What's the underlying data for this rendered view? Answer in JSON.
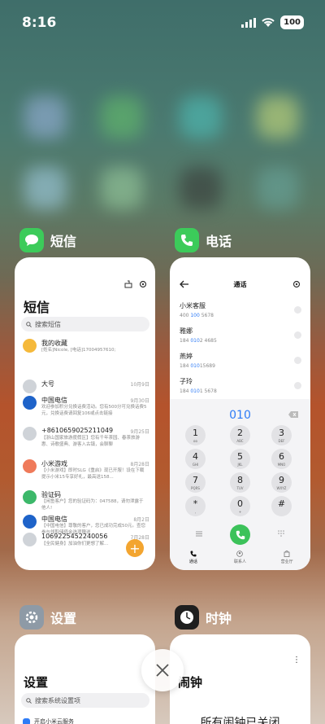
{
  "status_bar": {
    "time": "8:16",
    "battery": "100"
  },
  "recent_apps": {
    "sms": {
      "label": "短信",
      "title": "短信",
      "search_placeholder": "搜索短信",
      "messages": [
        {
          "name": "我的收藏",
          "date": "",
          "preview": "[姓名]Nicole, [电话]17004957610;",
          "avatar_color": "#f5b93b"
        },
        {
          "name": "大号",
          "date": "10月9日",
          "preview": "",
          "avatar_color": "#cfd3d8"
        },
        {
          "name": "中国电信",
          "date": "9月30日",
          "preview": "欢迎参加积分兑换话费活动。您有500分可兑换话费5元，兑换话费请回复106或点击链接",
          "avatar_color": "#1e63c9"
        },
        {
          "name": "+8610659025211049",
          "date": "9月25日",
          "preview": "【浙山国家旅游度假区】您有千年茶园、春茶旅游惠、诗歌盛典、游客入古镇，会聊聊",
          "avatar_color": "#cfd3d8"
        },
        {
          "name": "小米游戏",
          "date": "8月28日",
          "preview": "【小米游戏】即时SLG《重启》现已开服！设在下载提示小米15专享好礼，最高送158...",
          "avatar_color": "#ef7a5a"
        },
        {
          "name": "验证码",
          "date": "",
          "preview": "【闲鱼客户】您的验证码为：047588，请勿泄露于他人!",
          "avatar_color": "#3cb86a"
        },
        {
          "name": "中国电信",
          "date": "8月2日",
          "preview": "【中国电信】尊敬的客户，您已成功完成50元。查您参与领取储值金选项赠送",
          "avatar_color": "#1e63c9"
        },
        {
          "name": "1069225452240056",
          "date": "7月28日",
          "preview": "【全民健身】加油你们更想了解...",
          "avatar_color": "#cfd3d8"
        }
      ]
    },
    "phone": {
      "label": "电话",
      "title": "通话",
      "contacts": [
        {
          "name": "小米客服",
          "number_pre": "400 ",
          "number_hl": "100",
          "number_post": " 5678"
        },
        {
          "name": "雅娜",
          "number_pre": "184 ",
          "number_hl": "010",
          "number_post": "2 4685"
        },
        {
          "name": "燕婷",
          "number_pre": "184 ",
          "number_hl": "010",
          "number_post": "15689"
        },
        {
          "name": "子玲",
          "number_pre": "184 ",
          "number_hl": "010",
          "number_post": "1 5678"
        }
      ],
      "dialed": "010",
      "keys": [
        {
          "d": "1",
          "l": "oo"
        },
        {
          "d": "2",
          "l": "ABC"
        },
        {
          "d": "3",
          "l": "DEF"
        },
        {
          "d": "4",
          "l": "GHI"
        },
        {
          "d": "5",
          "l": "JKL"
        },
        {
          "d": "6",
          "l": "MNO"
        },
        {
          "d": "7",
          "l": "PQRS"
        },
        {
          "d": "8",
          "l": "TUV"
        },
        {
          "d": "9",
          "l": "WXYZ"
        },
        {
          "d": "*",
          "l": ","
        },
        {
          "d": "0",
          "l": "+"
        },
        {
          "d": "#",
          "l": ""
        }
      ],
      "tabs": [
        "通话",
        "联系人",
        "营业厅"
      ]
    },
    "settings": {
      "label": "设置",
      "title": "设置",
      "search_placeholder": "搜索系统设置项",
      "first_item": "开启小米云服务"
    },
    "clock": {
      "label": "时钟",
      "title": "闹钟",
      "status": "所有闹钟已关闭"
    }
  },
  "colors": {
    "accent": "#2f7cf6",
    "sms_icon": "#3ccb5a",
    "phone_icon": "#3ccb5a",
    "fab": "#f3a530"
  }
}
